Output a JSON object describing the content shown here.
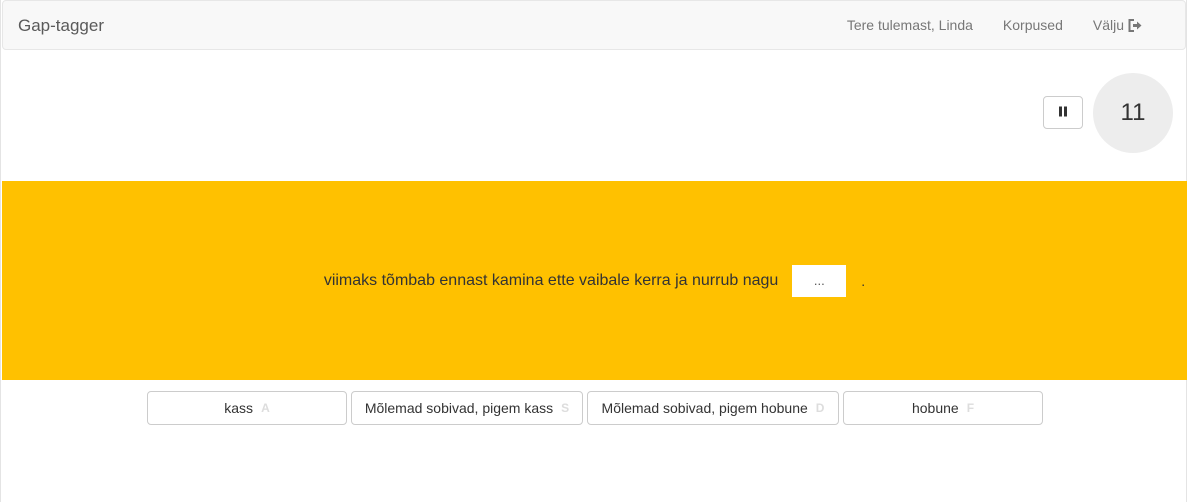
{
  "navbar": {
    "brand": "Gap-tagger",
    "welcome": "Tere tulemast, Linda",
    "corpora": "Korpused",
    "logout": "Välju",
    "logout_icon": "sign-out-icon"
  },
  "controls": {
    "pause_icon": "pause-icon",
    "timer_value": "11"
  },
  "task": {
    "sentence": "viimaks tõmbab ennast kamina ette vaibale kerra ja nurrub nagu",
    "gap_placeholder": "...",
    "sentence_end": "."
  },
  "answers": [
    {
      "label": "kass",
      "hotkey": "A"
    },
    {
      "label": "Mõlemad sobivad, pigem kass",
      "hotkey": "S"
    },
    {
      "label": "Mõlemad sobivad, pigem hobune",
      "hotkey": "D"
    },
    {
      "label": "hobune",
      "hotkey": "F"
    }
  ],
  "colors": {
    "banner": "#ffc100",
    "navbar_bg": "#f8f8f8",
    "timer_bg": "#ededed"
  }
}
